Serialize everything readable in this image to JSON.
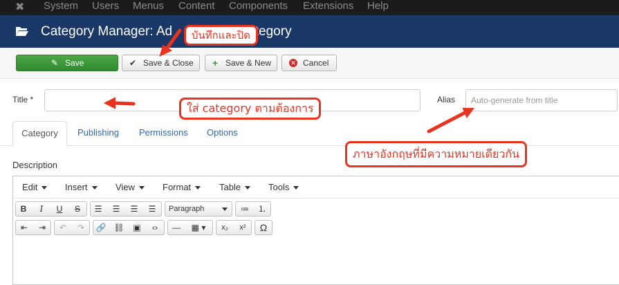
{
  "topbar": {
    "logo_icon": "joomla-logo-icon",
    "menu": [
      "System",
      "Users",
      "Menus",
      "Content",
      "Components",
      "Extensions",
      "Help"
    ]
  },
  "header": {
    "title_prefix": "Category Manager: Ad",
    "title_suffix": "es Category"
  },
  "toolbar": {
    "save": "Save",
    "save_close": "Save & Close",
    "save_new": "Save & New",
    "cancel": "Cancel"
  },
  "form": {
    "title_label": "Title *",
    "title_value": "",
    "alias_label": "Alias",
    "alias_placeholder": "Auto-generate from title"
  },
  "tabs": [
    "Category",
    "Publishing",
    "Permissions",
    "Options"
  ],
  "description_label": "Description",
  "editor": {
    "menus": [
      "Edit",
      "Insert",
      "View",
      "Format",
      "Table",
      "Tools"
    ],
    "format_select": "Paragraph"
  },
  "annotations": {
    "save_close": "บันทึกและปิด",
    "title": "ใส่ category ตามต้องการ",
    "alias": "ภาษาอังกฤษที่มีความหมายเดียวกัน"
  },
  "colors": {
    "header_bg": "#1a3867",
    "save_green": "#3c9a3c",
    "callout_red": "#e8331f",
    "link_blue": "#2a69b8"
  }
}
